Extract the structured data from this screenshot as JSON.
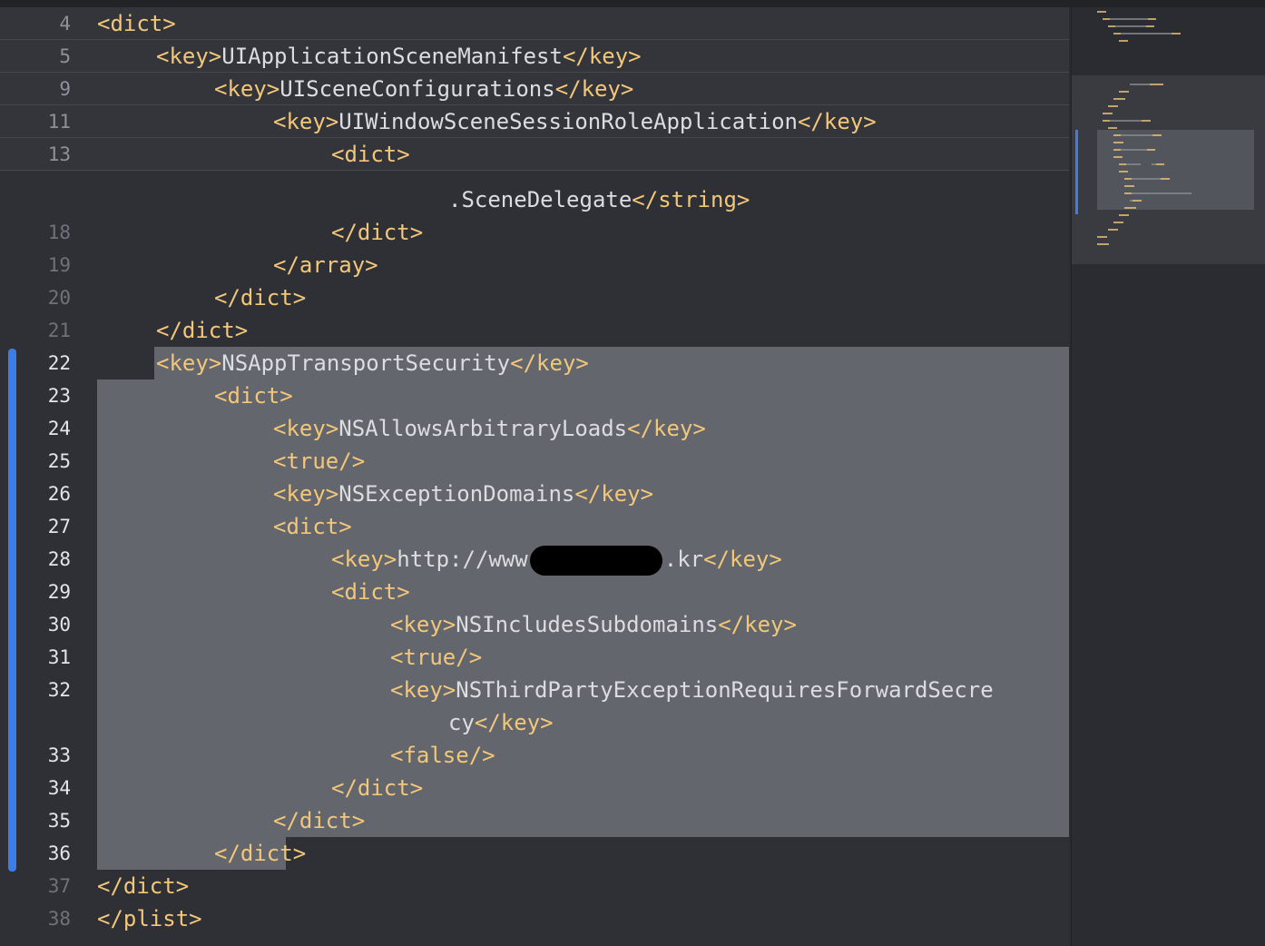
{
  "colors": {
    "editor_background": "#2f3035",
    "selection": "#63666d",
    "tag": "#f2c77a",
    "text": "#dcdde1",
    "change_bar": "#3c7ee8"
  },
  "sticky_header": [
    {
      "line": "4",
      "indent": 0,
      "code": [
        [
          "tag",
          "<dict>"
        ]
      ]
    },
    {
      "line": "5",
      "indent": 1,
      "code": [
        [
          "tag",
          "<key>"
        ],
        [
          "text",
          "UIApplicationSceneManifest"
        ],
        [
          "tag",
          "</key>"
        ]
      ]
    },
    {
      "line": "9",
      "indent": 2,
      "code": [
        [
          "tag",
          "<key>"
        ],
        [
          "text",
          "UISceneConfigurations"
        ],
        [
          "tag",
          "</key>"
        ]
      ]
    },
    {
      "line": "11",
      "indent": 3,
      "code": [
        [
          "tag",
          "<key>"
        ],
        [
          "text",
          "UIWindowSceneSessionRoleApplication"
        ],
        [
          "tag",
          "</key>"
        ]
      ]
    },
    {
      "line": "13",
      "indent": 4,
      "code": [
        [
          "tag",
          "<dict>"
        ]
      ]
    }
  ],
  "lines": [
    {
      "line": "",
      "indent": 0,
      "code": []
    },
    {
      "line": "",
      "indent": 0,
      "code": []
    },
    {
      "line": "",
      "indent": 0,
      "code": []
    },
    {
      "line": "",
      "indent": 0,
      "code": []
    },
    {
      "line": "",
      "indent": 0,
      "code": []
    },
    {
      "line": "",
      "indent": 6,
      "code": [
        [
          "text",
          ".SceneDelegate"
        ],
        [
          "tag",
          "</string>"
        ]
      ]
    },
    {
      "line": "18",
      "indent": 4,
      "code": [
        [
          "tag",
          "</dict>"
        ]
      ]
    },
    {
      "line": "19",
      "indent": 3,
      "code": [
        [
          "tag",
          "</array>"
        ]
      ]
    },
    {
      "line": "20",
      "indent": 2,
      "code": [
        [
          "tag",
          "</dict>"
        ]
      ]
    },
    {
      "line": "21",
      "indent": 1,
      "code": [
        [
          "tag",
          "</dict>"
        ]
      ]
    },
    {
      "line": "22",
      "indent": 1,
      "selected": true,
      "code": [
        [
          "tag",
          "<key>"
        ],
        [
          "text",
          "NSAppTransportSecurity"
        ],
        [
          "tag",
          "</key>"
        ]
      ]
    },
    {
      "line": "23",
      "indent": 2,
      "selected": true,
      "code": [
        [
          "tag",
          "<dict>"
        ]
      ]
    },
    {
      "line": "24",
      "indent": 3,
      "selected": true,
      "code": [
        [
          "tag",
          "<key>"
        ],
        [
          "text",
          "NSAllowsArbitraryLoads"
        ],
        [
          "tag",
          "</key>"
        ]
      ]
    },
    {
      "line": "25",
      "indent": 3,
      "selected": true,
      "code": [
        [
          "tag",
          "<true/>"
        ]
      ]
    },
    {
      "line": "26",
      "indent": 3,
      "selected": true,
      "code": [
        [
          "tag",
          "<key>"
        ],
        [
          "text",
          "NSExceptionDomains"
        ],
        [
          "tag",
          "</key>"
        ]
      ]
    },
    {
      "line": "27",
      "indent": 3,
      "selected": true,
      "code": [
        [
          "tag",
          "<dict>"
        ]
      ]
    },
    {
      "line": "28",
      "indent": 4,
      "selected": true,
      "code": [
        [
          "tag",
          "<key>"
        ],
        [
          "text",
          "http://www"
        ],
        [
          "redact",
          ""
        ],
        [
          "text",
          ".kr"
        ],
        [
          "tag",
          "</key>"
        ]
      ]
    },
    {
      "line": "29",
      "indent": 4,
      "selected": true,
      "code": [
        [
          "tag",
          "<dict>"
        ]
      ]
    },
    {
      "line": "30",
      "indent": 5,
      "selected": true,
      "code": [
        [
          "tag",
          "<key>"
        ],
        [
          "text",
          "NSIncludesSubdomains"
        ],
        [
          "tag",
          "</key>"
        ]
      ]
    },
    {
      "line": "31",
      "indent": 5,
      "selected": true,
      "code": [
        [
          "tag",
          "<true/>"
        ]
      ]
    },
    {
      "line": "32",
      "indent": 5,
      "selected": true,
      "code": [
        [
          "tag",
          "<key>"
        ],
        [
          "text",
          "NSThirdPartyExceptionRequiresForwardSecre"
        ]
      ]
    },
    {
      "line": "",
      "indent": 6,
      "selected": true,
      "code": [
        [
          "text",
          "cy"
        ],
        [
          "tag",
          "</key>"
        ]
      ]
    },
    {
      "line": "33",
      "indent": 5,
      "selected": true,
      "code": [
        [
          "tag",
          "<false/>"
        ]
      ]
    },
    {
      "line": "34",
      "indent": 4,
      "selected": true,
      "code": [
        [
          "tag",
          "</dict>"
        ]
      ]
    },
    {
      "line": "35",
      "indent": 3,
      "selected": true,
      "code": [
        [
          "tag",
          "</dict>"
        ]
      ]
    },
    {
      "line": "36",
      "indent": 2,
      "selected": true,
      "code": [
        [
          "tag",
          "</dict>"
        ]
      ]
    },
    {
      "line": "37",
      "indent": 0,
      "code": [
        [
          "tag",
          "</dict>"
        ]
      ]
    },
    {
      "line": "38",
      "indent": 0,
      "code": [
        [
          "tag",
          "</plist>"
        ]
      ]
    }
  ]
}
